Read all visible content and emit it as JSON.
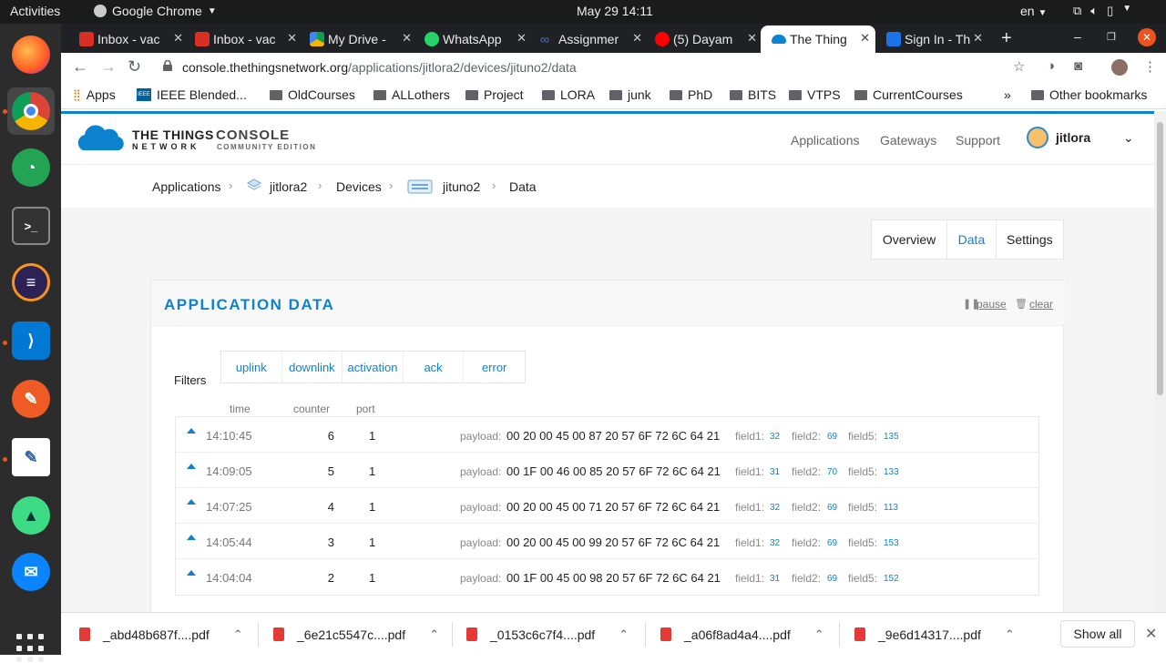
{
  "system": {
    "activities": "Activities",
    "app_name": "Google Chrome",
    "clock": "May 29  14:11",
    "lang": "en"
  },
  "tabs": [
    {
      "label": "Inbox - vac",
      "color": "#d93025"
    },
    {
      "label": "Inbox - vac",
      "color": "#d93025"
    },
    {
      "label": "My Drive - ",
      "color": "#1a73e8"
    },
    {
      "label": "WhatsApp",
      "color": "#25d366"
    },
    {
      "label": "Assignmer",
      "color": "#4a6fd6"
    },
    {
      "label": "(5) Dayam",
      "color": "#ff0000"
    },
    {
      "label": "The Thing",
      "color": "#0d83d0"
    },
    {
      "label": "Sign In - Th",
      "color": "#1a73e8"
    }
  ],
  "address": {
    "host": "console.thethingsnetwork.org",
    "path": "/applications/jitlora2/devices/jituno2/data"
  },
  "bookmarks": {
    "apps": "Apps",
    "items": [
      "IEEE Blended...",
      "OldCourses",
      "ALLothers",
      "Project",
      "LORA",
      "junk",
      "PhD",
      "BITS",
      "VTPS",
      "CurrentCourses"
    ],
    "more": "»",
    "other": "Other bookmarks"
  },
  "ttn": {
    "logo_line1": "THE THINGS",
    "logo_line2": "NETWORK",
    "console": "CONSOLE",
    "console_sub": "COMMUNITY EDITION",
    "nav": {
      "applications": "Applications",
      "gateways": "Gateways",
      "support": "Support"
    },
    "user": "jitlora"
  },
  "breadcrumb": {
    "applications": "Applications",
    "app": "jitlora2",
    "devices": "Devices",
    "device": "jituno2",
    "current": "Data"
  },
  "device_tabs": {
    "overview": "Overview",
    "data": "Data",
    "settings": "Settings"
  },
  "panel": {
    "title": "APPLICATION DATA",
    "pause": "pause",
    "clear": "clear",
    "filters_label": "Filters",
    "filters": [
      "uplink",
      "downlink",
      "activation",
      "ack",
      "error"
    ],
    "columns": {
      "time": "time",
      "counter": "counter",
      "port": "port"
    },
    "payload_label": "payload:",
    "field_labels": [
      "field1:",
      "field2:",
      "field5:"
    ]
  },
  "rows": [
    {
      "time": "14:10:45",
      "counter": "6",
      "port": "1",
      "payload": "00 20 00 45 00 87 20 57 6F 72 6C 64 21",
      "field1": "32",
      "field2": "69",
      "field5": "135"
    },
    {
      "time": "14:09:05",
      "counter": "5",
      "port": "1",
      "payload": "00 1F 00 46 00 85 20 57 6F 72 6C 64 21",
      "field1": "31",
      "field2": "70",
      "field5": "133"
    },
    {
      "time": "14:07:25",
      "counter": "4",
      "port": "1",
      "payload": "00 20 00 45 00 71 20 57 6F 72 6C 64 21",
      "field1": "32",
      "field2": "69",
      "field5": "113"
    },
    {
      "time": "14:05:44",
      "counter": "3",
      "port": "1",
      "payload": "00 20 00 45 00 99 20 57 6F 72 6C 64 21",
      "field1": "32",
      "field2": "69",
      "field5": "153"
    },
    {
      "time": "14:04:04",
      "counter": "2",
      "port": "1",
      "payload": "00 1F 00 45 00 98 20 57 6F 72 6C 64 21",
      "field1": "31",
      "field2": "69",
      "field5": "152"
    }
  ],
  "downloads": {
    "files": [
      "_abd48b687f....pdf",
      "_6e21c5547c....pdf",
      "_0153c6c7f4....pdf",
      "_a06f8ad4a4....pdf",
      "_9e6d14317....pdf"
    ],
    "show_all": "Show all"
  },
  "colors": {
    "accent": "#0d83d0",
    "ubuntu_orange": "#e95420"
  }
}
